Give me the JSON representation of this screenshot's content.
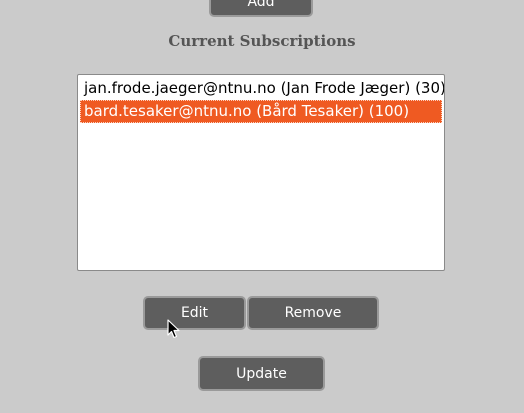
{
  "top_button": {
    "label": "Add"
  },
  "section": {
    "title": "Current Subscriptions"
  },
  "subscriptions": [
    {
      "text": "jan.frode.jaeger@ntnu.no (Jan Frode Jæger) (30)",
      "selected": false
    },
    {
      "text": "bard.tesaker@ntnu.no (Bård Tesaker) (100)",
      "selected": true
    }
  ],
  "actions": {
    "edit_label": "Edit",
    "remove_label": "Remove",
    "update_label": "Update"
  },
  "colors": {
    "background": "#cbcbcb",
    "button": "#5e5e5e",
    "selection": "#ef5a22",
    "title": "#555555"
  },
  "icons": {
    "cursor": "mouse-pointer-icon"
  }
}
